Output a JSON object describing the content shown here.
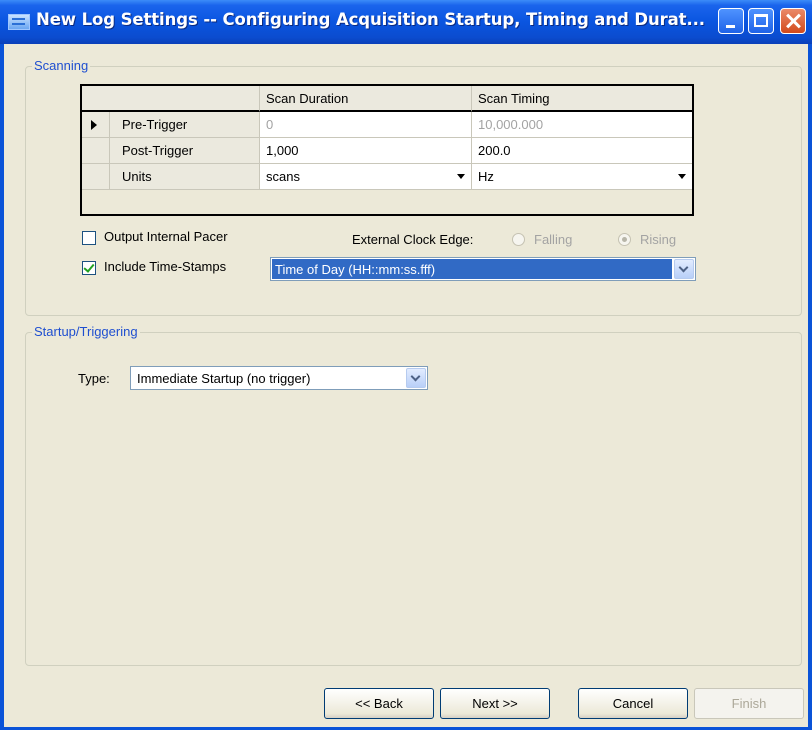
{
  "window": {
    "title": "New Log Settings -- Configuring Acquisition Startup, Timing and Durat..."
  },
  "scanning": {
    "label": "Scanning",
    "grid": {
      "columns": [
        "Scan Duration",
        "Scan Timing"
      ],
      "rows": [
        {
          "label": "Pre-Trigger",
          "duration": "0",
          "timing": "10,000.000"
        },
        {
          "label": "Post-Trigger",
          "duration": "1,000",
          "timing": "200.0"
        },
        {
          "label": "Units",
          "duration": "scans",
          "timing": "Hz"
        }
      ]
    },
    "output_pacer": {
      "label": "Output Internal Pacer",
      "checked": false
    },
    "external_clock": {
      "label": "External Clock Edge:",
      "falling": "Falling",
      "rising": "Rising",
      "selected": "Rising"
    },
    "timestamps": {
      "label": "Include Time-Stamps",
      "checked": true,
      "value": "Time of Day (HH::mm:ss.fff)"
    }
  },
  "startup": {
    "label": "Startup/Triggering",
    "type_label": "Type:",
    "type_value": "Immediate Startup (no trigger)"
  },
  "buttons": {
    "back": "<< Back",
    "next": "Next >>",
    "cancel": "Cancel",
    "finish": "Finish"
  }
}
